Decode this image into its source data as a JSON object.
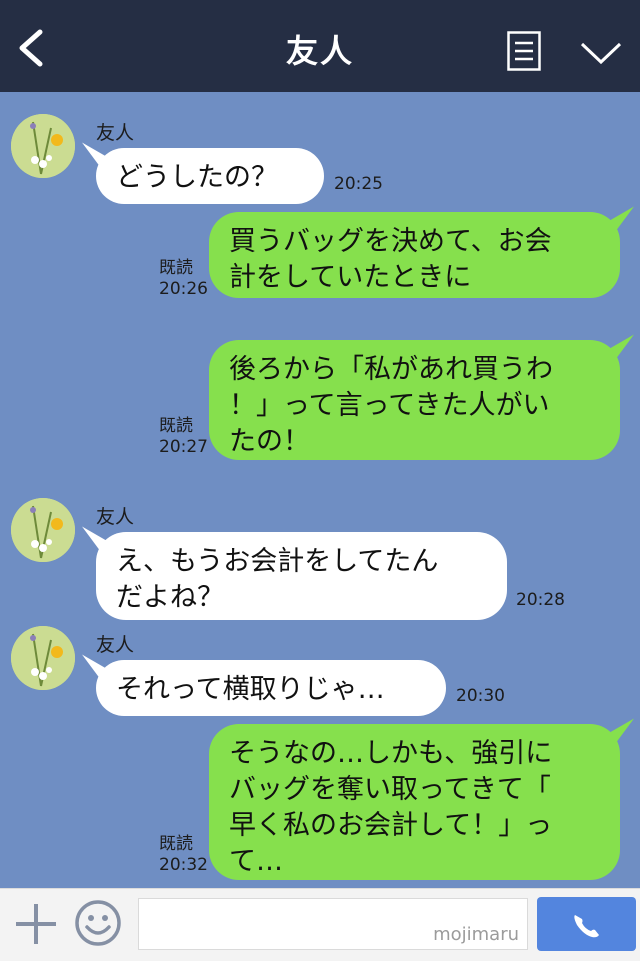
{
  "header": {
    "title": "友人",
    "back_icon": "chevron-left-icon",
    "menu_icon": "menu-document-icon",
    "more_icon": "chevron-down-icon"
  },
  "messages": [
    {
      "side": "left",
      "sender": "友人",
      "text": "どうしたの？",
      "time": "20:25"
    },
    {
      "side": "right",
      "text": "買うバッグを決めて、お会\n計をしていたときに",
      "read": "既読",
      "time": "20:26"
    },
    {
      "side": "right",
      "text": "後ろから「私があれ買うわ\n！」って言ってきた人がい\nたの！",
      "read": "既読",
      "time": "20:27"
    },
    {
      "side": "left",
      "sender": "友人",
      "text": "え、もうお会計をしてたん\nだよね？",
      "time": "20:28"
    },
    {
      "side": "left",
      "sender": "友人",
      "text": "それって横取りじゃ…",
      "time": "20:30"
    },
    {
      "side": "right",
      "text": "そうなの…しかも、強引に\nバッグを奪い取ってきて「\n早く私のお会計して！」っ\nて…",
      "read": "既読",
      "time": "20:32"
    }
  ],
  "footer": {
    "plus_icon": "plus-icon",
    "sticker_icon": "smiley-icon",
    "input_value": "",
    "watermark": "mojimaru",
    "call_icon": "phone-icon"
  },
  "colors": {
    "header_bg": "#252e44",
    "chat_bg": "#6f8ec3",
    "bubble_left": "#ffffff",
    "bubble_right": "#86e04d",
    "call_button": "#5385de"
  }
}
